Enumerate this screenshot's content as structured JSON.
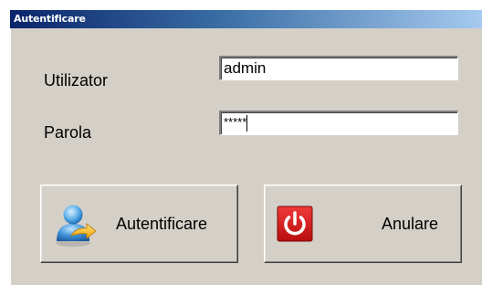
{
  "window": {
    "title": "Autentificare"
  },
  "form": {
    "username_label": "Utilizator",
    "username_value": "admin",
    "password_label": "Parola",
    "password_value": "*****"
  },
  "buttons": {
    "login_label": "Autentificare",
    "login_icon": "user-login-icon",
    "cancel_label": "Anulare",
    "cancel_icon": "power-icon"
  },
  "colors": {
    "title_bar": "#0a246a",
    "dialog_bg": "#d4d0c8",
    "power_icon": "#d01818"
  }
}
